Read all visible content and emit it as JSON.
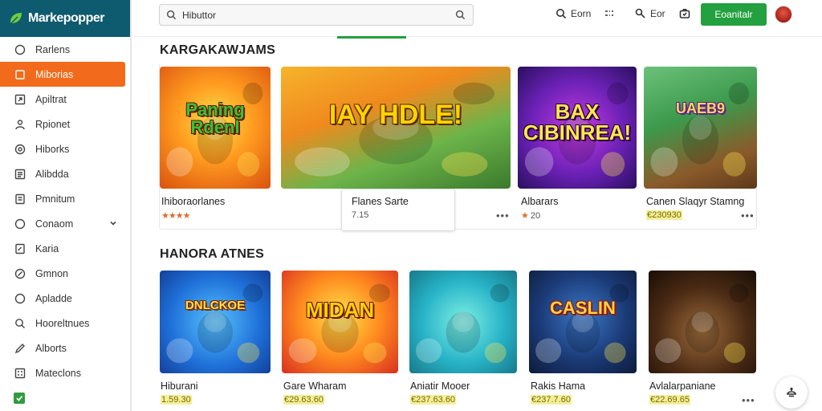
{
  "brand": {
    "name": "Markepopper",
    "color": "#0e5a6e"
  },
  "colors": {
    "accent": "#f26a1b",
    "primary": "#23a03f",
    "price_highlight": "#f4ef9a"
  },
  "sidebar": {
    "items": [
      {
        "label": "Rarlens",
        "icon": "circle-icon",
        "active": false
      },
      {
        "label": "Miborias",
        "icon": "square-icon",
        "active": true
      },
      {
        "label": "Apiltrat",
        "icon": "expand-icon",
        "active": false
      },
      {
        "label": "Rpionet",
        "icon": "user-icon",
        "active": false
      },
      {
        "label": "Hiborks",
        "icon": "gamepad-icon",
        "active": false
      },
      {
        "label": "Alibdda",
        "icon": "list-icon",
        "active": false
      },
      {
        "label": "Pmnitum",
        "icon": "document-icon",
        "active": false
      },
      {
        "label": "Conaom",
        "icon": "circle-icon",
        "active": false,
        "has_dropdown": true
      },
      {
        "label": "Karia",
        "icon": "doc-edit-icon",
        "active": false
      },
      {
        "label": "Gmnon",
        "icon": "tag-icon",
        "active": false
      },
      {
        "label": "Apladde",
        "icon": "circle-icon",
        "active": false
      },
      {
        "label": "Hooreltnues",
        "icon": "search-icon",
        "active": false
      },
      {
        "label": "Alborts",
        "icon": "pencil-icon",
        "active": false
      },
      {
        "label": "Mateclons",
        "icon": "grid-icon",
        "active": false
      }
    ]
  },
  "topbar": {
    "search_value": "Hibuttor",
    "tools": [
      {
        "label": "Eorn",
        "icon": "search-icon"
      },
      {
        "label": "",
        "icon": "dots-icon"
      },
      {
        "label": "Eor",
        "icon": "magnify-icon"
      },
      {
        "label": "",
        "icon": "camera-icon"
      }
    ],
    "primary_button": "Eoanitalr"
  },
  "sections": [
    {
      "title": "KARGAKAWJAMS",
      "cards": [
        {
          "title": "Ihiboraorlanes",
          "sub": "★★★★",
          "sub_type": "stars",
          "art_text": "Paning Rdenl",
          "art_theme": "orange"
        },
        {
          "title": "Flanes Sarte",
          "sub": "7.15",
          "sub_type": "plain",
          "art_text": "IAY HDLE!",
          "art_theme": "adventure"
        },
        {
          "title": "Albarars",
          "sub": "20",
          "rating_star": "★",
          "sub_type": "star-plain",
          "art_text": "BAX CIBINREA!",
          "art_theme": "purple"
        },
        {
          "title": "Canen Slaqyr Stamng",
          "sub": "€230930",
          "sub_type": "price",
          "art_text": "UAEB9",
          "art_theme": "jungle"
        }
      ]
    },
    {
      "title": "HANORA ATNES",
      "cards": [
        {
          "title": "Hiburani",
          "sub": "1.59.30",
          "sub_type": "price",
          "art_text": "DNLCKOE",
          "art_theme": "blue"
        },
        {
          "title": "Gare Wharam",
          "sub": "€29.63.60",
          "sub_type": "price",
          "art_text": "MIDAN",
          "art_theme": "yellow"
        },
        {
          "title": "Aniatir Mooer",
          "sub": "€237.63.60",
          "sub_type": "price",
          "art_text": "",
          "art_theme": "cyan"
        },
        {
          "title": "Rakis Hama",
          "sub": "€237.7.60",
          "sub_type": "price",
          "art_text": "CASLIN",
          "art_theme": "dark"
        },
        {
          "title": "Avlalarpaniane",
          "sub": "€22.69.65",
          "sub_type": "price",
          "art_text": "",
          "art_theme": "mine"
        }
      ]
    }
  ],
  "more_label": "•••",
  "fab_icon": "chat-icon"
}
